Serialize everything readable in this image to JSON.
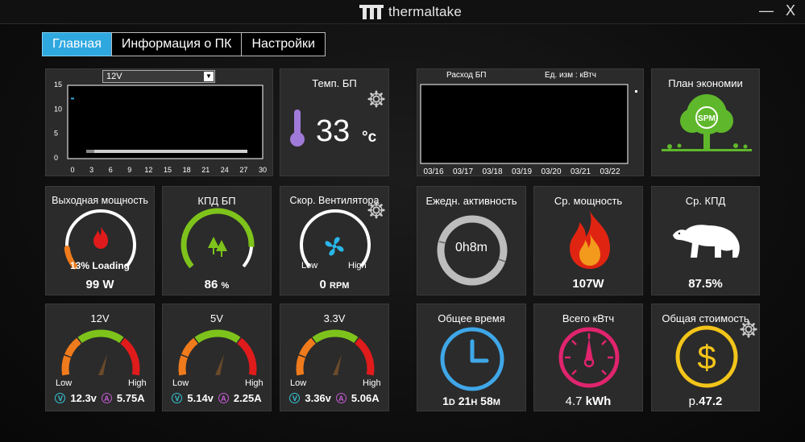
{
  "window": {
    "brand": "thermaltake",
    "minimize": "—",
    "close": "X"
  },
  "tabs": [
    {
      "label": "Главная",
      "active": true
    },
    {
      "label": "Информация о ПК",
      "active": false
    },
    {
      "label": "Настройки",
      "active": false
    }
  ],
  "rail_chart": {
    "selected": "12V",
    "chart_data": {
      "type": "line",
      "x_ticks": [
        "0",
        "3",
        "6",
        "9",
        "12",
        "15",
        "18",
        "21",
        "24",
        "27",
        "30"
      ],
      "y_ticks": [
        "15",
        "10",
        "5",
        "0"
      ],
      "ylim": [
        0,
        15
      ],
      "xlim": [
        0,
        30
      ],
      "series": [
        {
          "x": [
            0,
            0.5
          ],
          "y": [
            12.3,
            12.3
          ]
        }
      ]
    }
  },
  "temp": {
    "title": "Темп. БП",
    "value": "33",
    "unit": "°c"
  },
  "consumption": {
    "title": "Расход БП",
    "unit_label": "Ед. изм : кВтч",
    "chart_data": {
      "type": "bar",
      "categories": [
        "03/16",
        "03/17",
        "03/18",
        "03/19",
        "03/20",
        "03/21",
        "03/22"
      ],
      "values": [
        0,
        0,
        0,
        0,
        0,
        0,
        0
      ]
    }
  },
  "eco": {
    "title": "План экономии",
    "logo_text": "SPM"
  },
  "output_power": {
    "title": "Выходная мощность",
    "loading_pct": "13",
    "loading_label": "% Loading",
    "loading_fraction": 0.13,
    "value": "99",
    "unit": "W"
  },
  "efficiency": {
    "title": "КПД БП",
    "value": "86",
    "unit": "%",
    "fraction": 0.86
  },
  "fan": {
    "title": "Скор. Вентилятора",
    "low": "Low",
    "high": "High",
    "value": "0",
    "unit": "RPM"
  },
  "daily": {
    "title": "Ежедн. активность",
    "value": "0h8m"
  },
  "avg_power": {
    "title": "Ср. мощность",
    "value": "107",
    "unit": "W"
  },
  "avg_eff": {
    "title": "Ср. КПД",
    "value": "87.5%"
  },
  "rails": [
    {
      "title": "12V",
      "low": "Low",
      "high": "High",
      "v_icon": "V",
      "a_icon": "A",
      "volt": "12.3v",
      "amp": "5.75A"
    },
    {
      "title": "5V",
      "low": "Low",
      "high": "High",
      "v_icon": "V",
      "a_icon": "A",
      "volt": "5.14v",
      "amp": "2.25A"
    },
    {
      "title": "3.3V",
      "low": "Low",
      "high": "High",
      "v_icon": "V",
      "a_icon": "A",
      "volt": "3.36v",
      "amp": "5.06A"
    }
  ],
  "total_time": {
    "title": "Общее время",
    "d": "1",
    "d_unit": "D",
    "h": "21",
    "h_unit": "H",
    "m": "58",
    "m_unit": "M"
  },
  "total_kwh": {
    "title": "Всего кВтч",
    "value": "4.7",
    "unit": "kWh"
  },
  "total_cost": {
    "title": "Общая стоимость",
    "prefix": "р.",
    "value": "47.2"
  },
  "colors": {
    "accent": "#2fa8e0",
    "gauge_green": "#7ec31b",
    "gauge_red": "#e01b1b",
    "gauge_orange": "#f07b1c",
    "cyan": "#36c6d8",
    "magenta": "#c65ad4",
    "clock_blue": "#3fa7e8",
    "pink": "#e0246e",
    "gold": "#f3c51a"
  }
}
